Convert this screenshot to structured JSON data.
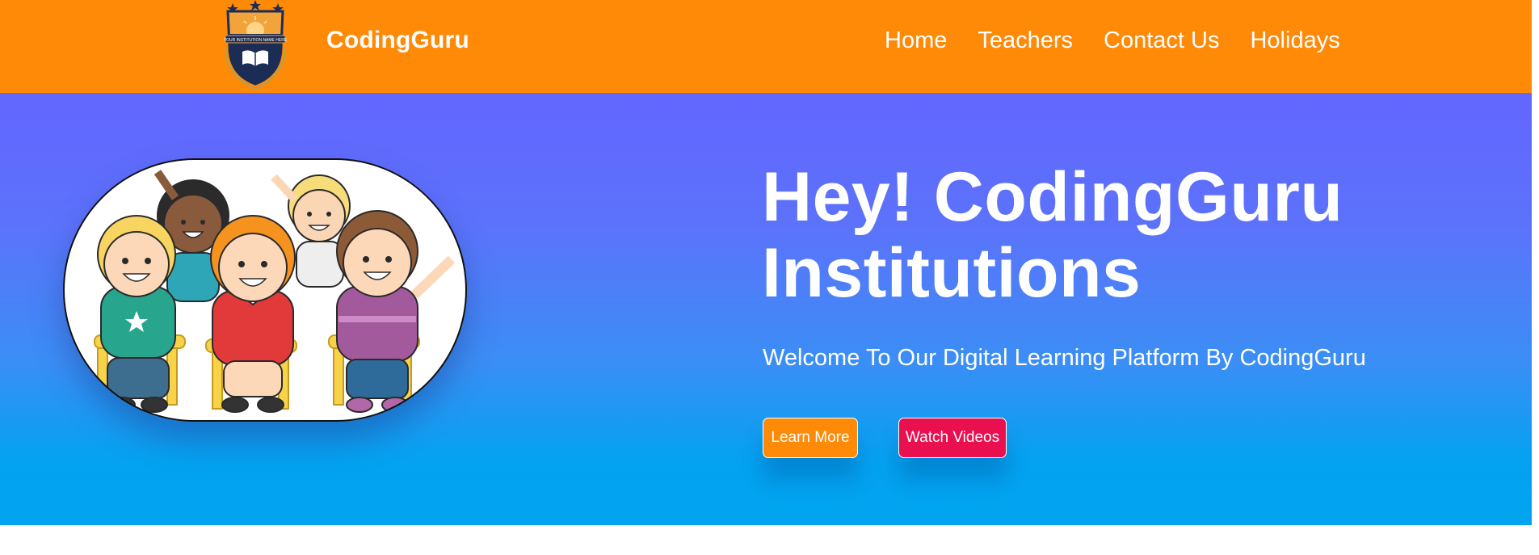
{
  "navbar": {
    "brand": "CodingGuru",
    "logo_text": "YOUR INSTITUTION NAME HERE",
    "links": [
      "Home",
      "Teachers",
      "Contact Us",
      "Holidays"
    ]
  },
  "hero": {
    "title_line1": "Hey! CodingGuru",
    "title_line2": "Institutions",
    "subtitle": "Welcome To Our Digital Learning Platform By CodingGuru",
    "buttons": {
      "learn_more": "Learn More",
      "watch_videos": "Watch Videos"
    }
  },
  "colors": {
    "navbar": "#ff8a08",
    "hero_gradient_top": "#6366ff",
    "hero_gradient_bottom": "#00a4ef",
    "learn_more_button": "#ff8a08",
    "watch_videos_button": "#ea0f4f",
    "text": "#ffffff"
  },
  "icons": {
    "logo": "school-crest-icon",
    "hero_image": "children-in-classroom-illustration"
  }
}
